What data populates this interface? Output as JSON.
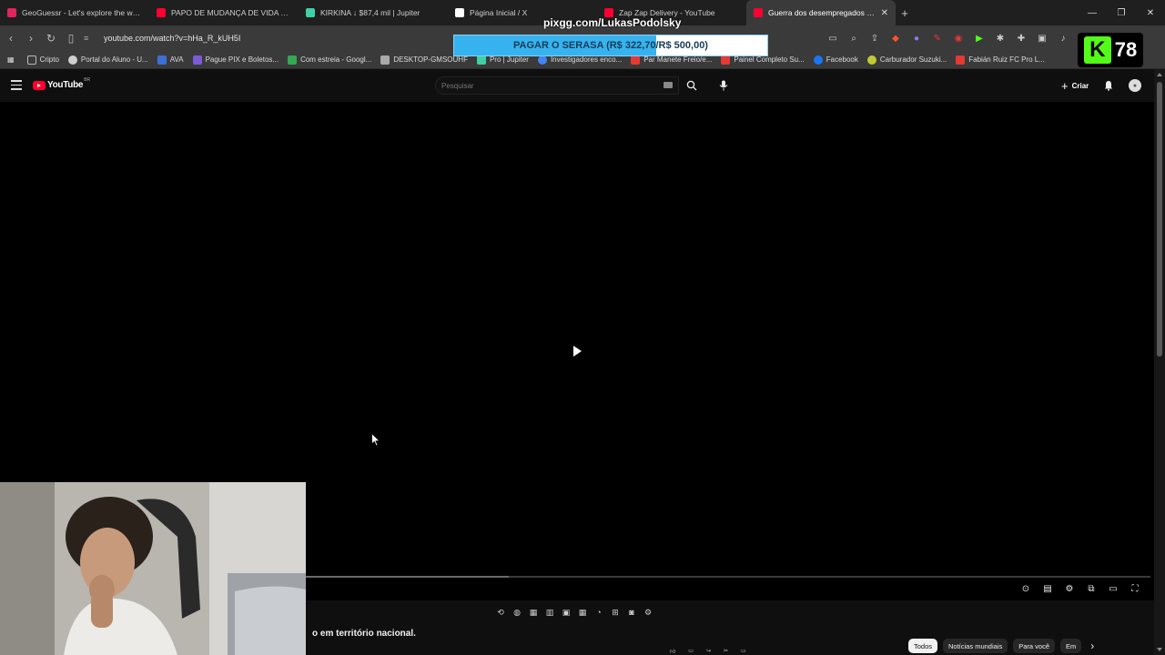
{
  "browser": {
    "tabs": [
      {
        "label": "GeoGuessr - Let's explore the world!",
        "color": "#e0245e"
      },
      {
        "label": "PAPO DE MUDANÇA DE VIDA COM F",
        "color": "#ff0033"
      },
      {
        "label": "KIRKINA ↓ $87,4 mil | Jupiter",
        "color": "#3fd1a6"
      },
      {
        "label": "Página Inicial / X",
        "color": "#ffffff"
      },
      {
        "label": "Zap Zap Delivery - YouTube",
        "color": "#ff0033"
      },
      {
        "label": "Guerra dos desempregados está",
        "color": "#ff0033",
        "active": true
      }
    ],
    "new_tab": "+",
    "url": "youtube.com/watch?v=hHa_R_kUH5I",
    "bookmarks": [
      {
        "label": "Cripto",
        "color": "#bbbbbb"
      },
      {
        "label": "Portal do Aluno - U...",
        "color": "#cfcfcf"
      },
      {
        "label": "AVA",
        "color": "#3b6fd6"
      },
      {
        "label": "Pague PIX e Boletos...",
        "color": "#7b5bd6"
      },
      {
        "label": "Com estreia - Googl...",
        "color": "#34a853"
      },
      {
        "label": "DESKTOP-GMSOUHF",
        "color": "#aaaaaa"
      },
      {
        "label": "Pro | Jupiter",
        "color": "#3fd1a6"
      },
      {
        "label": "Investigadores enco...",
        "color": "#4285f4"
      },
      {
        "label": "Par Manete Freio/e...",
        "color": "#e53935"
      },
      {
        "label": "Painel Completo Su...",
        "color": "#e53935"
      },
      {
        "label": "Facebook",
        "color": "#1877f2"
      },
      {
        "label": "Carburador Suzuki...",
        "color": "#c0ca33"
      },
      {
        "label": "Fabián Ruiz FC Pro L...",
        "color": "#e53935"
      }
    ]
  },
  "overlay": {
    "pix_url": "pixgg.com/LukasPodolsky",
    "goal_text": "PAGAR O SERASA (R$ 322,70/R$ 500,00)",
    "goal_progress": 0.6454,
    "kick_logo": "K",
    "kick_count": "78"
  },
  "youtube": {
    "logo_text": "YouTube",
    "country": "BR",
    "search_placeholder": "Pesquisar",
    "create_label": "Criar",
    "video_title_visible": "o em território nacional.",
    "progress": 0.24,
    "chips": [
      "Todos",
      "Notícias mundiais",
      "Para você",
      "Em"
    ]
  },
  "colors": {
    "yt_red": "#ff0033",
    "goal_fill": "#36b3ef",
    "kick_green": "#53fc18"
  }
}
